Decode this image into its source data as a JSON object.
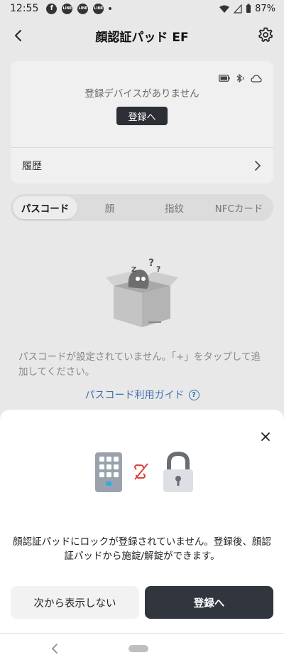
{
  "status_bar": {
    "time": "12:55",
    "notifications": [
      "facebook-icon",
      "line-icon",
      "line-icon",
      "line-icon"
    ],
    "line_label": "LINE",
    "battery": "87%"
  },
  "header": {
    "title": "顔認証パッド EF"
  },
  "device_card": {
    "empty_text": "登録デバイスがありません",
    "register_label": "登録へ",
    "history_label": "履歴"
  },
  "tabs": [
    {
      "label": "パスコード",
      "active": true
    },
    {
      "label": "顔",
      "active": false
    },
    {
      "label": "指紋",
      "active": false
    },
    {
      "label": "NFCカード",
      "active": false
    }
  ],
  "empty_state": {
    "message": "パスコードが設定されていません。「+」をタップして追加してください。",
    "guide_link": "パスコード利用ガイド"
  },
  "sheet": {
    "message": "顔認証パッドにロックが登録されていません。登録後、顔認証パッドから施錠/解錠ができます。",
    "later_label": "次から表示しない",
    "register_label": "登録へ"
  },
  "colors": {
    "primary_dark": "#31353d",
    "link": "#3f6fb0",
    "unlink_red": "#e0413a"
  }
}
